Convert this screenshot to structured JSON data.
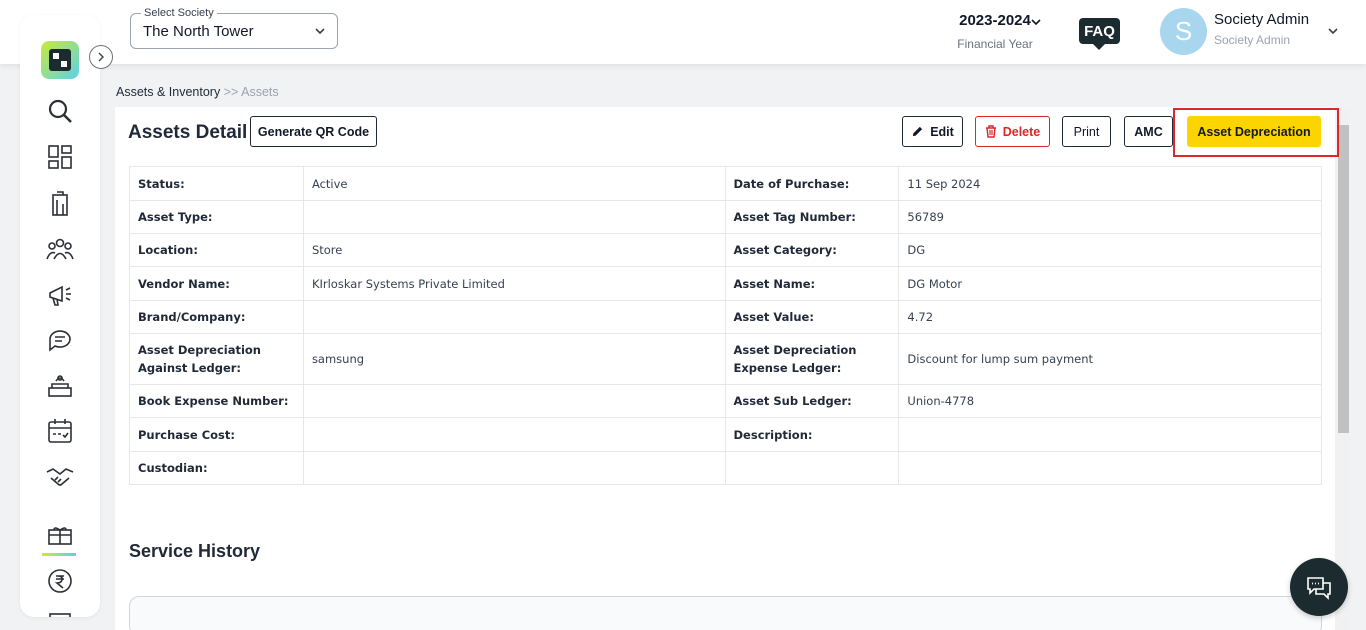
{
  "header": {
    "society": {
      "label": "Select Society",
      "value": "The North Tower"
    },
    "financial_year": {
      "year": "2023-2024",
      "label": "Financial Year"
    },
    "faq_label": "FAQ",
    "user": {
      "initial": "S",
      "name": "Society Admin",
      "role": "Society Admin"
    }
  },
  "sidebar": {
    "items": [
      "search-icon",
      "dashboard-icon",
      "building-icon",
      "members-icon",
      "announcement-icon",
      "chat-icon",
      "facility-icon",
      "calendar-icon",
      "handshake-icon",
      "assets-icon",
      "rupee-icon",
      "checkbox-icon"
    ],
    "active": "assets-icon"
  },
  "breadcrumb": {
    "parent": "Assets & Inventory",
    "separator": ">>",
    "current": "Assets"
  },
  "page": {
    "title": "Assets Detail",
    "buttons": {
      "qr": "Generate QR Code",
      "edit": "Edit",
      "delete": "Delete",
      "print": "Print",
      "amc": "AMC",
      "depreciation": "Asset Depreciation"
    }
  },
  "details": [
    {
      "l1": "Status:",
      "v1": "Active",
      "l2": "Date of Purchase:",
      "v2": "11 Sep 2024"
    },
    {
      "l1": "Asset Type:",
      "v1": "",
      "l2": "Asset Tag Number:",
      "v2": "56789"
    },
    {
      "l1": "Location:",
      "v1": "Store",
      "l2": "Asset Category:",
      "v2": "DG"
    },
    {
      "l1": "Vendor Name:",
      "v1": "KIrloskar Systems Private Limited",
      "l2": "Asset Name:",
      "v2": "DG Motor"
    },
    {
      "l1": "Brand/Company:",
      "v1": "",
      "l2": "Asset Value:",
      "v2": "4.72"
    },
    {
      "l1": "Asset Depreciation Against Ledger:",
      "v1": "samsung",
      "l2": "Asset Depreciation Expense Ledger:",
      "v2": "Discount for lump sum payment"
    },
    {
      "l1": "Book Expense Number:",
      "v1": "",
      "l2": "Asset Sub Ledger:",
      "v2": "Union-4778"
    },
    {
      "l1": "Purchase Cost:",
      "v1": "",
      "l2": "Description:",
      "v2": ""
    },
    {
      "l1": "Custodian:",
      "v1": "",
      "l2": "",
      "v2": ""
    }
  ],
  "service_history": {
    "title": "Service History"
  },
  "colors": {
    "accent": "#fcd400",
    "danger": "#dc2626",
    "dark": "#1c2b2f",
    "highlight": "#e0262d"
  }
}
